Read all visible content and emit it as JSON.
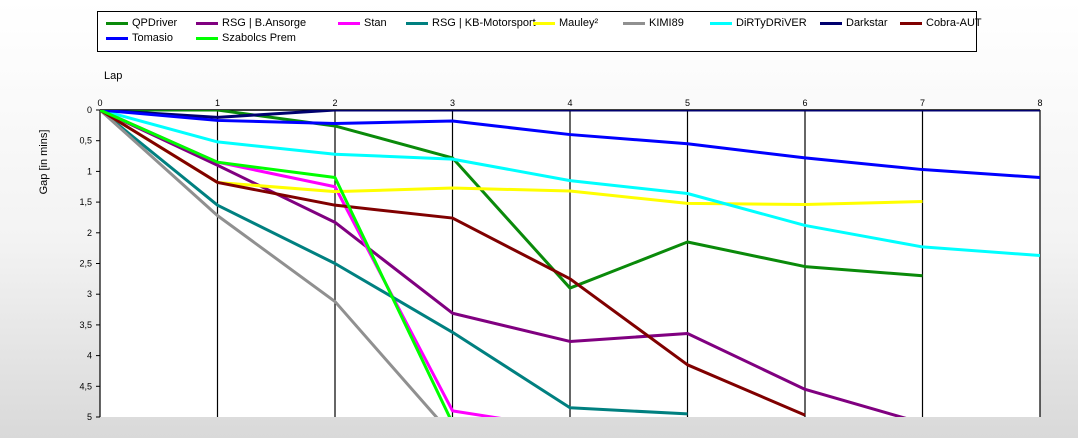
{
  "chart_data": {
    "type": "line",
    "xlabel": "Lap",
    "ylabel": "Gap [in mins]",
    "x": [
      0,
      1,
      2,
      3,
      4,
      5,
      6,
      7,
      8
    ],
    "xlim": [
      0,
      8
    ],
    "ylim": [
      0,
      5
    ],
    "y_inverted": true,
    "x_ticks": [
      "0",
      "1",
      "2",
      "3",
      "4",
      "5",
      "6",
      "7",
      "8"
    ],
    "y_ticks": [
      "0",
      "0,5",
      "1",
      "1,5",
      "2",
      "2,5",
      "3",
      "3,5",
      "4",
      "4,5",
      "5"
    ],
    "grid": true,
    "legend_position": "top",
    "series": [
      {
        "name": "QPDriver",
        "color": "#0a8a0a",
        "values": [
          0,
          0,
          0.26,
          0.78,
          2.9,
          2.15,
          2.55,
          2.7,
          null
        ]
      },
      {
        "name": "RSG | B.Ansorge",
        "color": "#800080",
        "values": [
          0,
          0.9,
          1.83,
          3.31,
          3.77,
          3.64,
          4.55,
          5.1,
          null
        ]
      },
      {
        "name": "Stan",
        "color": "#ff00ff",
        "values": [
          0,
          0.85,
          1.25,
          4.9,
          5.2,
          null,
          null,
          null,
          null
        ]
      },
      {
        "name": "RSG | KB-Motorsport",
        "color": "#008080",
        "values": [
          0,
          1.55,
          2.5,
          3.62,
          4.85,
          4.95,
          null,
          null,
          null
        ]
      },
      {
        "name": "Mauley²",
        "color": "#ffff00",
        "values": [
          0,
          1.18,
          1.33,
          1.27,
          1.32,
          1.52,
          1.54,
          1.49,
          null
        ]
      },
      {
        "name": "KIMI89",
        "color": "#909090",
        "values": [
          0,
          1.72,
          3.12,
          5.3,
          null,
          null,
          null,
          null,
          null
        ]
      },
      {
        "name": "DiRTyDRiVER",
        "color": "#00ffff",
        "values": [
          0,
          0.52,
          0.72,
          0.8,
          1.15,
          1.36,
          1.88,
          2.23,
          2.37
        ]
      },
      {
        "name": "Darkstar",
        "color": "#00006e",
        "values": [
          0,
          0.12,
          0,
          0,
          0,
          0,
          0,
          0,
          0
        ]
      },
      {
        "name": "Cobra-AUT",
        "color": "#800000",
        "values": [
          0,
          1.18,
          1.55,
          1.76,
          2.75,
          4.15,
          4.97,
          null,
          null
        ]
      },
      {
        "name": "Tomasio",
        "color": "#0000ff",
        "values": [
          0,
          0.17,
          0.22,
          0.18,
          0.4,
          0.55,
          0.78,
          0.97,
          1.1
        ]
      },
      {
        "name": "Szabolcs Prem",
        "color": "#00ff00",
        "values": [
          0,
          0.85,
          1.1,
          5.1,
          null,
          null,
          null,
          null,
          null
        ]
      }
    ]
  }
}
